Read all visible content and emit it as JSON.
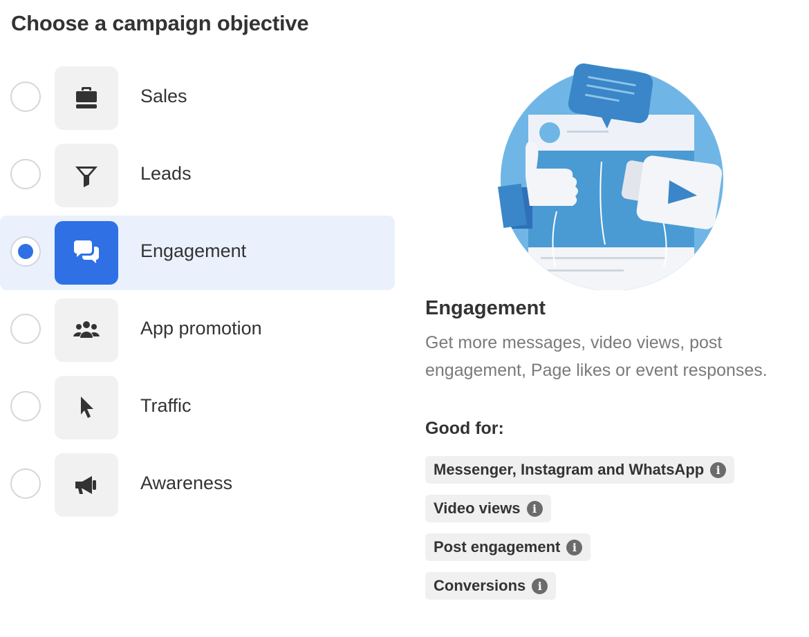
{
  "page_title": "Choose a campaign objective",
  "objectives": [
    {
      "label": "Sales",
      "icon": "briefcase-icon",
      "selected": false
    },
    {
      "label": "Leads",
      "icon": "filter-icon",
      "selected": false
    },
    {
      "label": "Engagement",
      "icon": "chat-bubbles-icon",
      "selected": true
    },
    {
      "label": "App promotion",
      "icon": "people-icon",
      "selected": false
    },
    {
      "label": "Traffic",
      "icon": "cursor-icon",
      "selected": false
    },
    {
      "label": "Awareness",
      "icon": "megaphone-icon",
      "selected": false
    }
  ],
  "detail": {
    "title": "Engagement",
    "description": "Get more messages, video views, post engagement, Page likes or event responses.",
    "good_for_label": "Good for:",
    "tags": [
      {
        "label": "Messenger, Instagram and WhatsApp",
        "icon": "info-icon"
      },
      {
        "label": "Video views",
        "icon": "info-icon"
      },
      {
        "label": "Post engagement",
        "icon": "info-icon"
      },
      {
        "label": "Conversions",
        "icon": "info-icon"
      }
    ]
  },
  "colors": {
    "accent": "#2f71e5",
    "selected_row_bg": "#eaf1fc",
    "tile_bg": "#f1f1f1",
    "text_primary": "#333333",
    "text_secondary": "#7a7a7a"
  }
}
